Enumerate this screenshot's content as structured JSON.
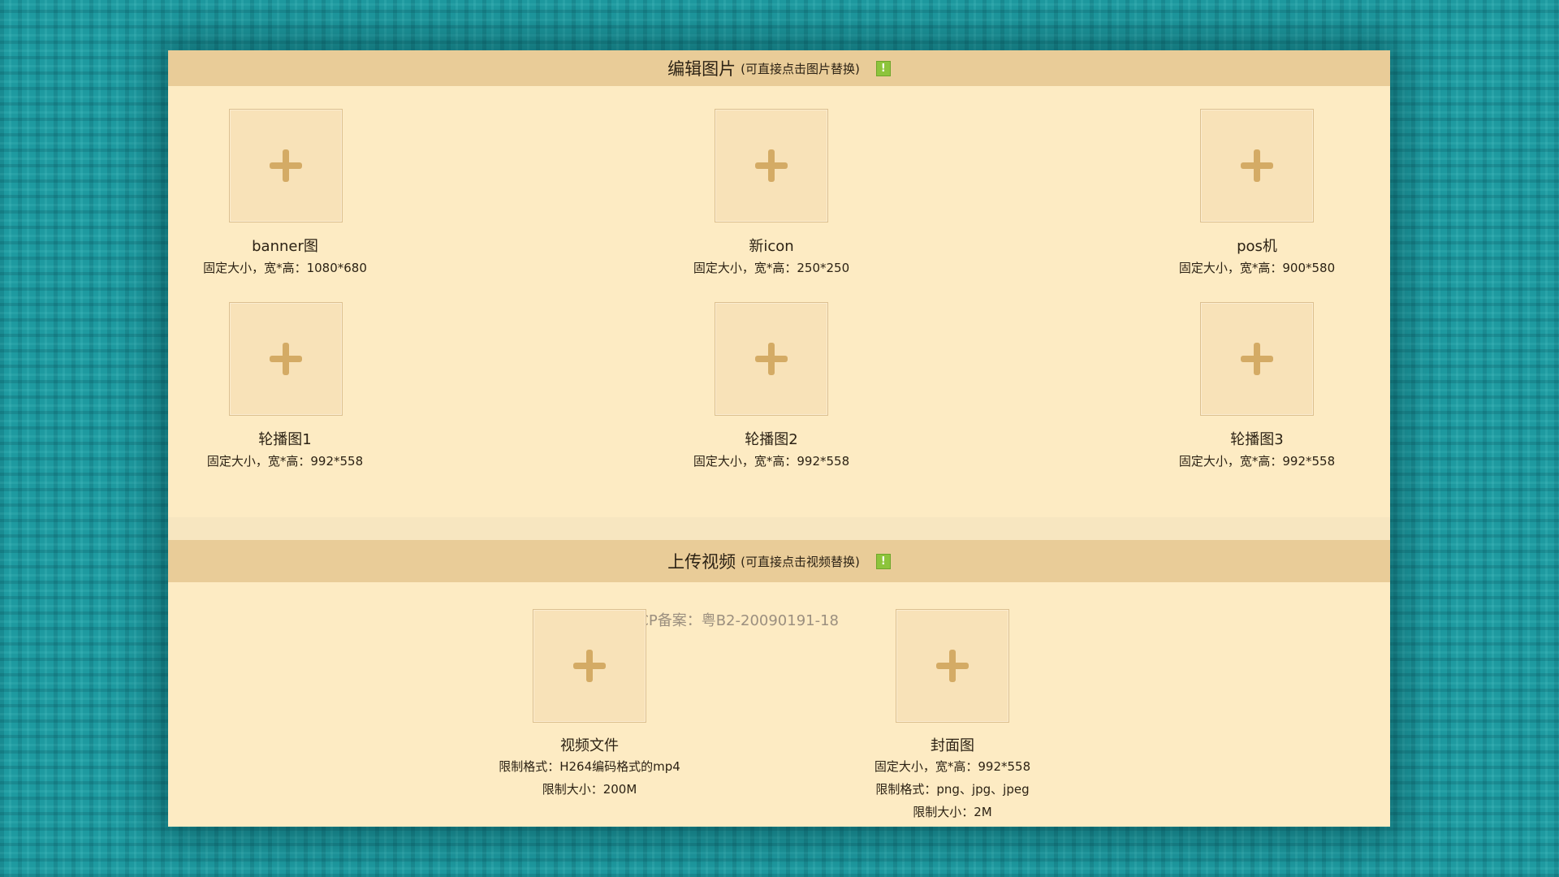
{
  "images_section": {
    "title": "编辑图片",
    "hint": "(可直接点击图片替换)",
    "warn_icon": "!",
    "items": [
      {
        "label": "banner图",
        "desc": "固定大小，宽*高：1080*680"
      },
      {
        "label": "新icon",
        "desc": "固定大小，宽*高：250*250"
      },
      {
        "label": "pos机",
        "desc": "固定大小，宽*高：900*580"
      },
      {
        "label": "轮播图1",
        "desc": "固定大小，宽*高：992*558"
      },
      {
        "label": "轮播图2",
        "desc": "固定大小，宽*高：992*558"
      },
      {
        "label": "轮播图3",
        "desc": "固定大小，宽*高：992*558"
      }
    ]
  },
  "video_section": {
    "title": "上传视频",
    "hint": "(可直接点击视频替换)",
    "warn_icon": "!",
    "video": {
      "label": "视频文件",
      "format": "限制格式：H264编码格式的mp4",
      "size": "限制大小：200M"
    },
    "cover": {
      "label": "封面图",
      "dimensions": "固定大小，宽*高：992*558",
      "format": "限制格式：png、jpg、jpeg",
      "size": "限制大小：2M"
    }
  },
  "icp": "ICP备案：粤B2-20090191-18",
  "icons": {
    "upload": "plus-icon",
    "notice": "exclamation-icon"
  },
  "colors": {
    "panel_bg": "#fdebc3",
    "header_bg": "#e9cc98",
    "plus": "#d4ab65",
    "notice": "#8dc43c"
  }
}
